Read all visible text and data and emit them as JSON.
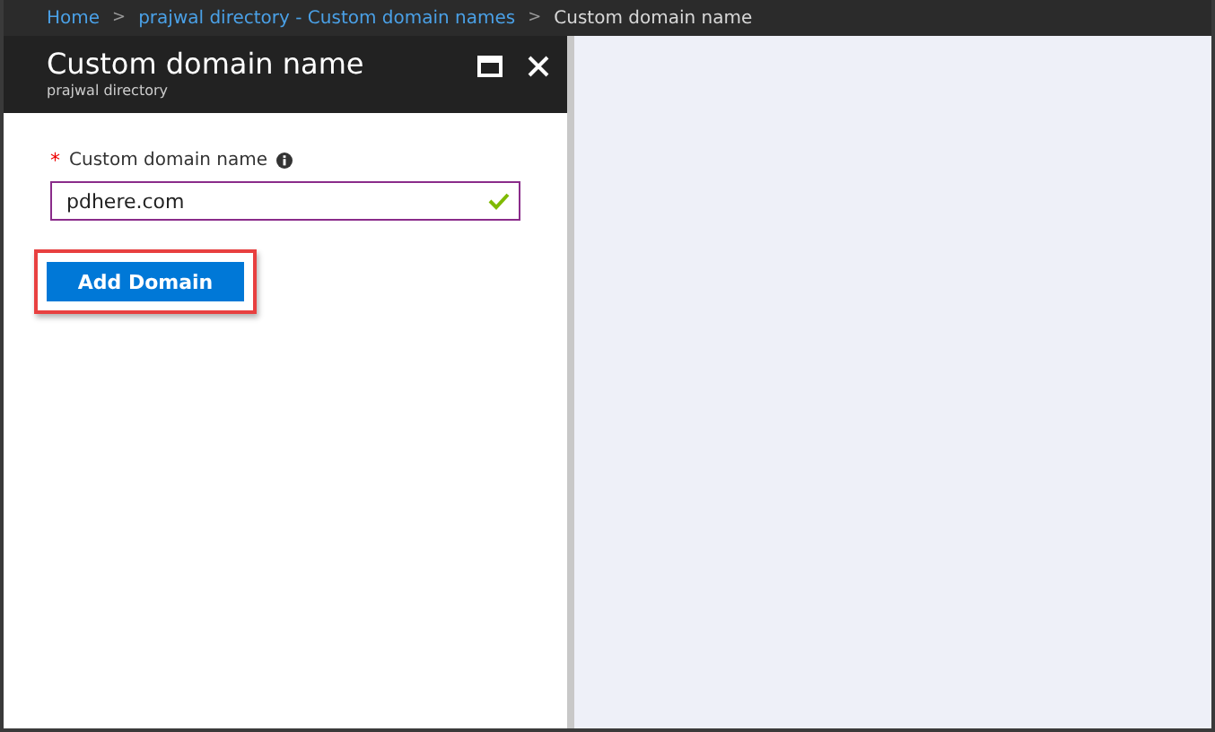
{
  "breadcrumb": [
    {
      "label": "Home",
      "current": false
    },
    {
      "label": "prajwal directory - Custom domain names",
      "current": false
    },
    {
      "label": "Custom domain name",
      "current": true
    }
  ],
  "breadcrumb_separator": ">",
  "blade": {
    "title": "Custom domain name",
    "subtitle": "prajwal directory"
  },
  "field": {
    "required_mark": "*",
    "label": "Custom domain name",
    "value": "pdhere.com",
    "valid": true
  },
  "button": {
    "label": "Add Domain",
    "highlighted": true
  }
}
